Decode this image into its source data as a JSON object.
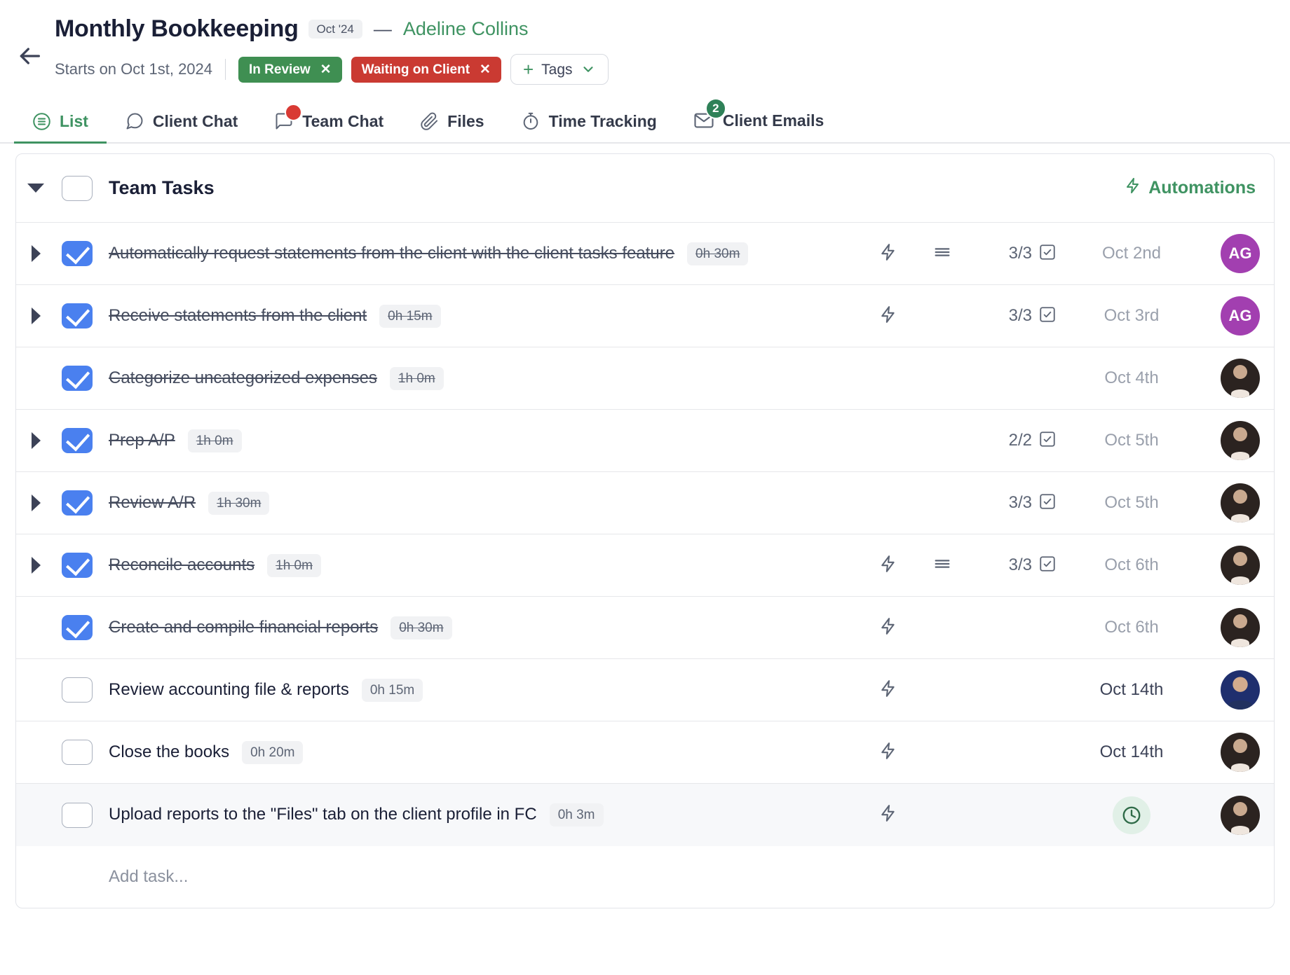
{
  "header": {
    "back_icon": "arrow-left-icon",
    "project_title": "Monthly Bookkeeping",
    "month_chip": "Oct '24",
    "dash": "—",
    "client_name": "Adeline Collins",
    "starts_on": "Starts on Oct 1st, 2024",
    "status_tags": [
      {
        "label": "In Review",
        "color": "#3f8f52",
        "close": "✕"
      },
      {
        "label": "Waiting on Client",
        "color": "#ca3a32",
        "close": "✕"
      }
    ],
    "tags_button": {
      "plus": "+",
      "label": "Tags",
      "chevron_icon": "chevron-down-icon"
    }
  },
  "tabs": [
    {
      "label": "List",
      "icon": "list-circle-icon",
      "active": true,
      "badge": null
    },
    {
      "label": "Client Chat",
      "icon": "chat-bubble-icon",
      "active": false,
      "badge": null
    },
    {
      "label": "Team Chat",
      "icon": "chat-square-icon",
      "active": false,
      "badge": "dot"
    },
    {
      "label": "Files",
      "icon": "paperclip-icon",
      "active": false,
      "badge": null
    },
    {
      "label": "Time Tracking",
      "icon": "stopwatch-icon",
      "active": false,
      "badge": null
    },
    {
      "label": "Client Emails",
      "icon": "envelope-icon",
      "active": false,
      "badge": "2"
    }
  ],
  "list": {
    "group_title": "Team Tasks",
    "group_expanded": true,
    "group_checked": false,
    "automations_label": "Automations",
    "automations_icon": "lightning-icon",
    "add_task_placeholder": "Add task...",
    "rows": [
      {
        "name": "Automatically request statements from the client with the client tasks feature",
        "time": "0h 30m",
        "done": true,
        "expandable": true,
        "bolt": true,
        "description": true,
        "subtasks": "3/3",
        "date": "Oct 2nd",
        "date_pending": false,
        "avatar_type": "initials",
        "avatar_text": "AG",
        "highlight": false,
        "clock": false
      },
      {
        "name": "Receive statements from the client",
        "time": "0h 15m",
        "done": true,
        "expandable": true,
        "bolt": true,
        "description": false,
        "subtasks": "3/3",
        "date": "Oct 3rd",
        "date_pending": false,
        "avatar_type": "initials",
        "avatar_text": "AG",
        "highlight": false,
        "clock": false
      },
      {
        "name": "Categorize uncategorized expenses",
        "time": "1h 0m",
        "done": true,
        "expandable": false,
        "bolt": false,
        "description": false,
        "subtasks": "",
        "date": "Oct 4th",
        "date_pending": false,
        "avatar_type": "photo-a",
        "avatar_text": "",
        "highlight": false,
        "clock": false
      },
      {
        "name": "Prep A/P",
        "time": "1h 0m",
        "done": true,
        "expandable": true,
        "bolt": false,
        "description": false,
        "subtasks": "2/2",
        "date": "Oct 5th",
        "date_pending": false,
        "avatar_type": "photo-a",
        "avatar_text": "",
        "highlight": false,
        "clock": false
      },
      {
        "name": "Review A/R",
        "time": "1h 30m",
        "done": true,
        "expandable": true,
        "bolt": false,
        "description": false,
        "subtasks": "3/3",
        "date": "Oct 5th",
        "date_pending": false,
        "avatar_type": "photo-a",
        "avatar_text": "",
        "highlight": false,
        "clock": false
      },
      {
        "name": "Reconcile accounts",
        "time": "1h 0m",
        "done": true,
        "expandable": true,
        "bolt": true,
        "description": true,
        "subtasks": "3/3",
        "date": "Oct 6th",
        "date_pending": false,
        "avatar_type": "photo-a",
        "avatar_text": "",
        "highlight": false,
        "clock": false
      },
      {
        "name": "Create and compile financial reports",
        "time": "0h 30m",
        "done": true,
        "expandable": false,
        "bolt": true,
        "description": false,
        "subtasks": "",
        "date": "Oct 6th",
        "date_pending": false,
        "avatar_type": "photo-a",
        "avatar_text": "",
        "highlight": false,
        "clock": false
      },
      {
        "name": "Review accounting file & reports",
        "time": "0h 15m",
        "done": false,
        "expandable": false,
        "bolt": true,
        "description": false,
        "subtasks": "",
        "date": "Oct 14th",
        "date_pending": true,
        "avatar_type": "photo-b",
        "avatar_text": "",
        "highlight": false,
        "clock": false
      },
      {
        "name": "Close the books",
        "time": "0h 20m",
        "done": false,
        "expandable": false,
        "bolt": true,
        "description": false,
        "subtasks": "",
        "date": "Oct 14th",
        "date_pending": true,
        "avatar_type": "photo-a",
        "avatar_text": "",
        "highlight": false,
        "clock": false
      },
      {
        "name": "Upload reports to the \"Files\" tab on the client profile in FC",
        "time": "0h 3m",
        "done": false,
        "expandable": false,
        "bolt": true,
        "description": false,
        "subtasks": "",
        "date": "",
        "date_pending": true,
        "avatar_type": "photo-a",
        "avatar_text": "",
        "highlight": true,
        "clock": true
      }
    ]
  },
  "colors": {
    "brand_green": "#3f9362",
    "checkbox_blue": "#4a80ef",
    "tag_green": "#3f8f52",
    "tag_red": "#ca3a32",
    "avatar_purple": "#a23fb0"
  }
}
